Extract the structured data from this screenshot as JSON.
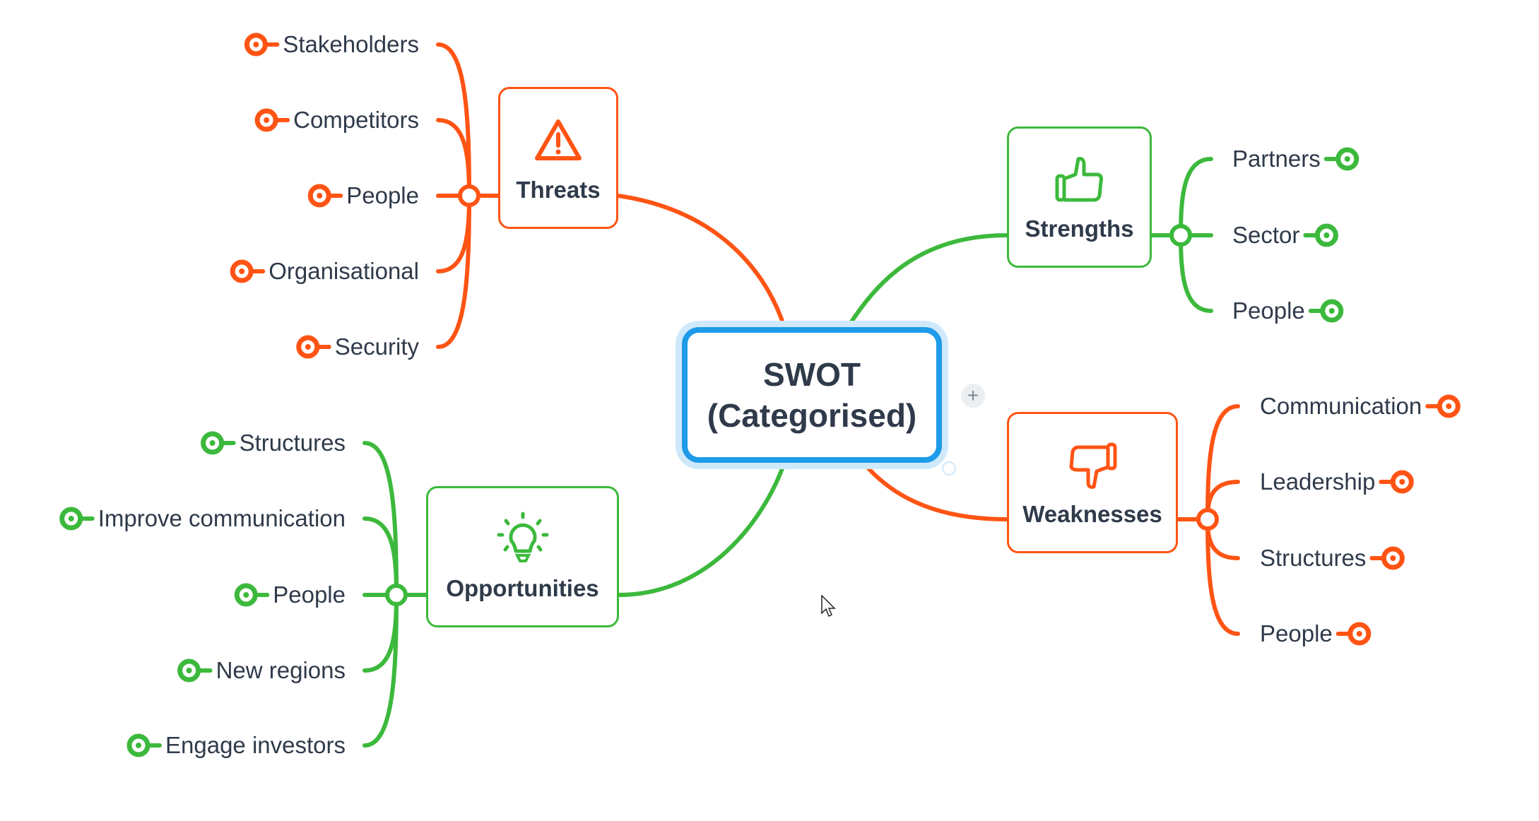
{
  "colors": {
    "threat": "#ff5414",
    "positive": "#3cb93c",
    "center": "#1e9be9",
    "text": "#2f3a4a"
  },
  "center": {
    "line1": "SWOT",
    "line2": "(Categorised)",
    "add_button": "+"
  },
  "branches": {
    "threats": {
      "label": "Threats",
      "icon": "warning-triangle-icon",
      "items": [
        "Stakeholders",
        "Competitors",
        "People",
        "Organisational",
        "Security"
      ]
    },
    "strengths": {
      "label": "Strengths",
      "icon": "thumbs-up-icon",
      "items": [
        "Partners",
        "Sector",
        "People"
      ]
    },
    "weaknesses": {
      "label": "Weaknesses",
      "icon": "thumbs-down-icon",
      "items": [
        "Communication",
        "Leadership",
        "Structures",
        "People"
      ]
    },
    "opportunities": {
      "label": "Opportunities",
      "icon": "lightbulb-icon",
      "items": [
        "Structures",
        "Improve communication",
        "People",
        "New regions",
        "Engage investors"
      ]
    }
  }
}
